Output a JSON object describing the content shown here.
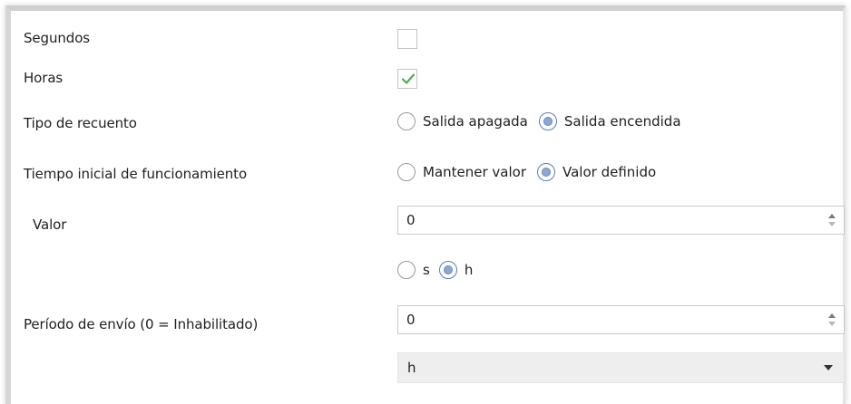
{
  "rows": {
    "seconds": {
      "label": "Segundos",
      "checked": false
    },
    "hours": {
      "label": "Horas",
      "checked": true
    },
    "count_type": {
      "label": "Tipo de recuento",
      "options": [
        "Salida apagada",
        "Salida encendida"
      ],
      "selected": "Salida encendida"
    },
    "initial_time": {
      "label": "Tiempo inicial de funcionamiento",
      "options": [
        "Mantener valor",
        "Valor definido"
      ],
      "selected": "Valor definido"
    },
    "value": {
      "label": "Valor",
      "value": "0"
    },
    "unit": {
      "options": [
        "s",
        "h"
      ],
      "selected": "h"
    },
    "send_period": {
      "label": "Período de envío (0 = Inhabilitado)",
      "value": "0",
      "unit_selected": "h"
    }
  },
  "colors": {
    "check_green": "#4caf50",
    "radio_selected": "#8da8d2"
  },
  "icons": {
    "check": "checkmark-icon",
    "spin": "spin-arrows-icon",
    "dropdown": "chevron-down-icon"
  }
}
